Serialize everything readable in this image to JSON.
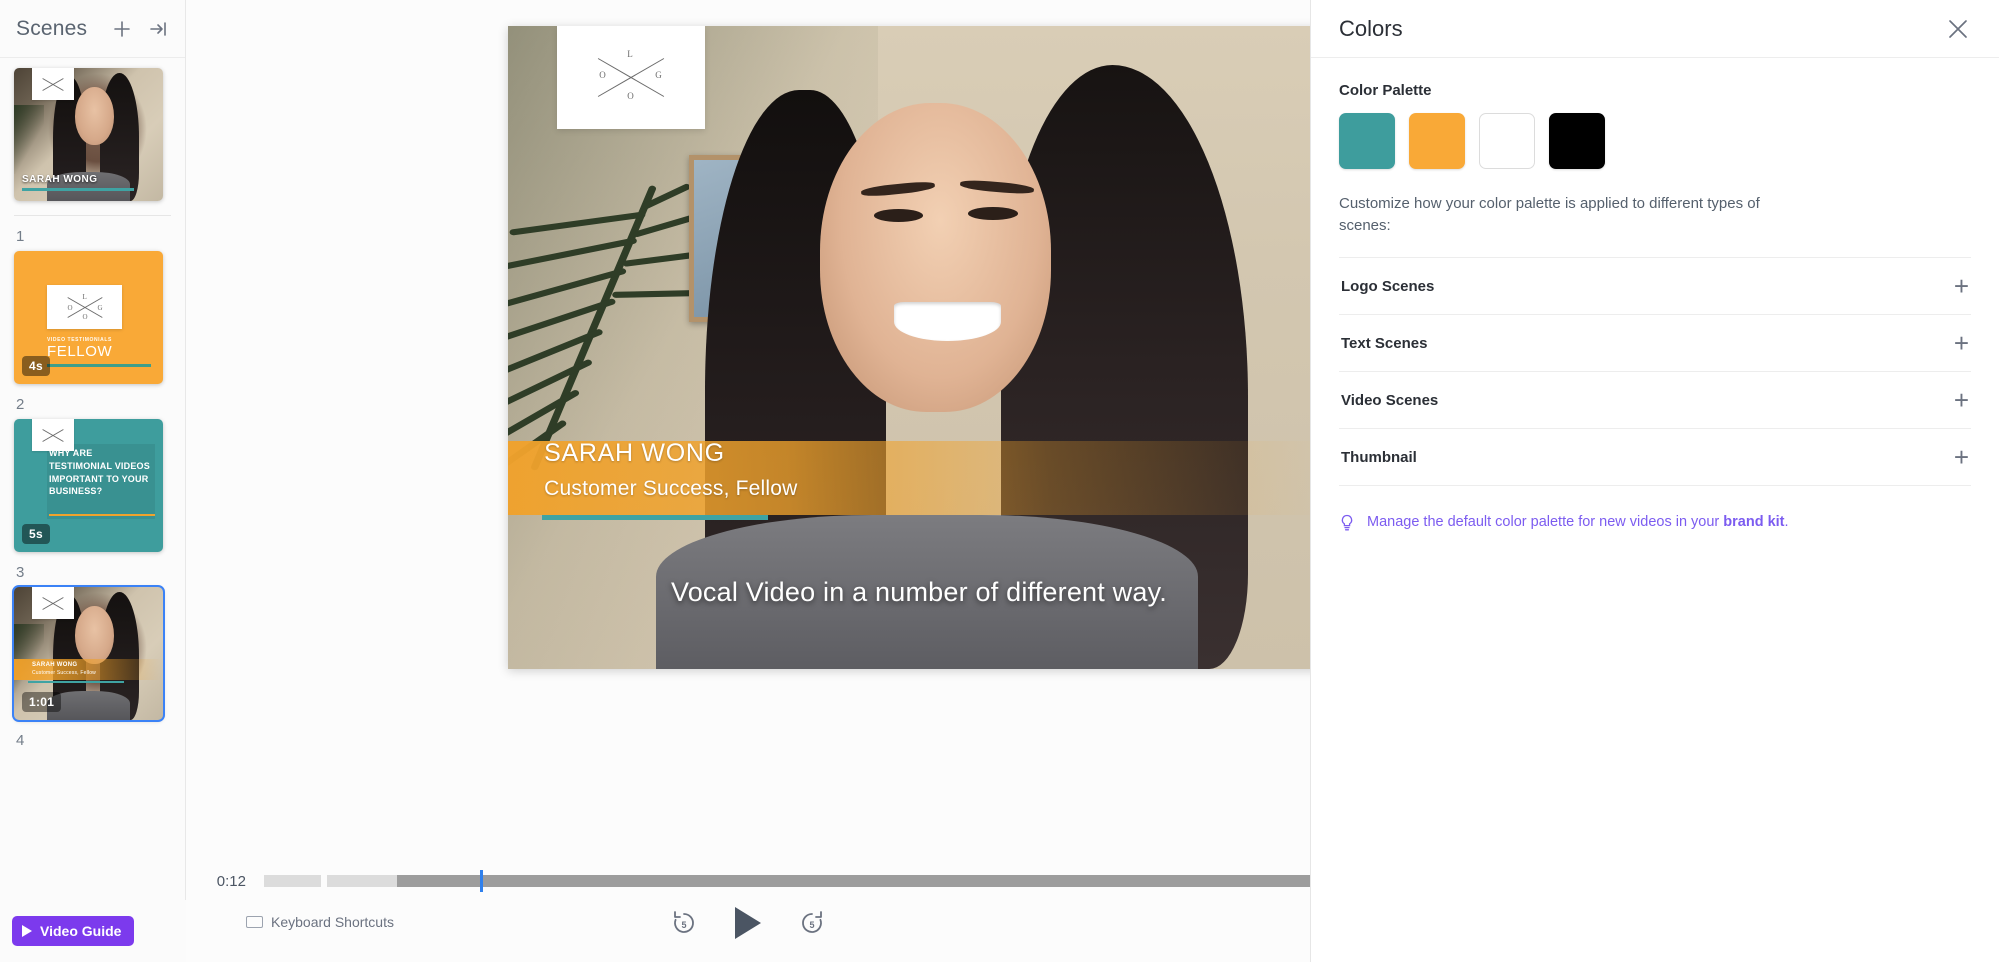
{
  "sidebar": {
    "title": "Scenes",
    "icons": {
      "add": "plus-icon",
      "collapse": "collapse-panel-icon"
    },
    "scenes": [
      {
        "index_label": "",
        "type": "video",
        "duration": "",
        "name": "SARAH WONG",
        "role": "",
        "selected": false
      },
      {
        "index_label": "1",
        "type": "logo",
        "duration": "4s",
        "kicker": "VIDEO TESTIMONIALS",
        "title": "FELLOW",
        "selected": false
      },
      {
        "index_label": "2",
        "type": "text",
        "duration": "5s",
        "text": "WHY ARE TESTIMONIAL VIDEOS IMPORTANT TO YOUR BUSINESS?",
        "selected": false
      },
      {
        "index_label": "3",
        "type": "video",
        "duration": "1:01",
        "name": "SARAH WONG",
        "role": "Customer Success, Fellow",
        "selected": true
      }
    ],
    "footer": {
      "video_guide_label": "Video Guide"
    }
  },
  "preview": {
    "lower_third": {
      "name": "SARAH WONG",
      "role": "Customer Success, Fellow"
    },
    "caption": "Vocal Video in a number of different way.",
    "logo": {
      "letters": [
        "L",
        "O",
        "G",
        "O"
      ]
    }
  },
  "timeline": {
    "current_time": "0:12"
  },
  "transport": {
    "keyboard_shortcuts_label": "Keyboard Shortcuts",
    "rewind_label": "5",
    "forward_label": "5",
    "play_label": "play-button"
  },
  "right_panel": {
    "title": "Colors",
    "close_label": "close-icon",
    "palette_label": "Color Palette",
    "swatches": [
      {
        "name": "teal",
        "hex": "#3e9d9d"
      },
      {
        "name": "orange",
        "hex": "#f9a937"
      },
      {
        "name": "white",
        "hex": "#ffffff"
      },
      {
        "name": "black",
        "hex": "#000000"
      }
    ],
    "description": "Customize how your color palette is applied to different types of scenes:",
    "rows": [
      {
        "label": "Logo Scenes",
        "action": "+"
      },
      {
        "label": "Text Scenes",
        "action": "+"
      },
      {
        "label": "Video Scenes",
        "action": "+"
      },
      {
        "label": "Thumbnail",
        "action": "+"
      }
    ],
    "hint": {
      "lead": "Manage the default color palette for new videos in your ",
      "link": "brand kit",
      "trail": "."
    }
  },
  "colors": {
    "accent_purple": "#7c3aed",
    "selection_blue": "#3b82f6",
    "playhead_blue": "#2f80ed",
    "teal": "#3e9d9d",
    "orange": "#f9a937"
  }
}
